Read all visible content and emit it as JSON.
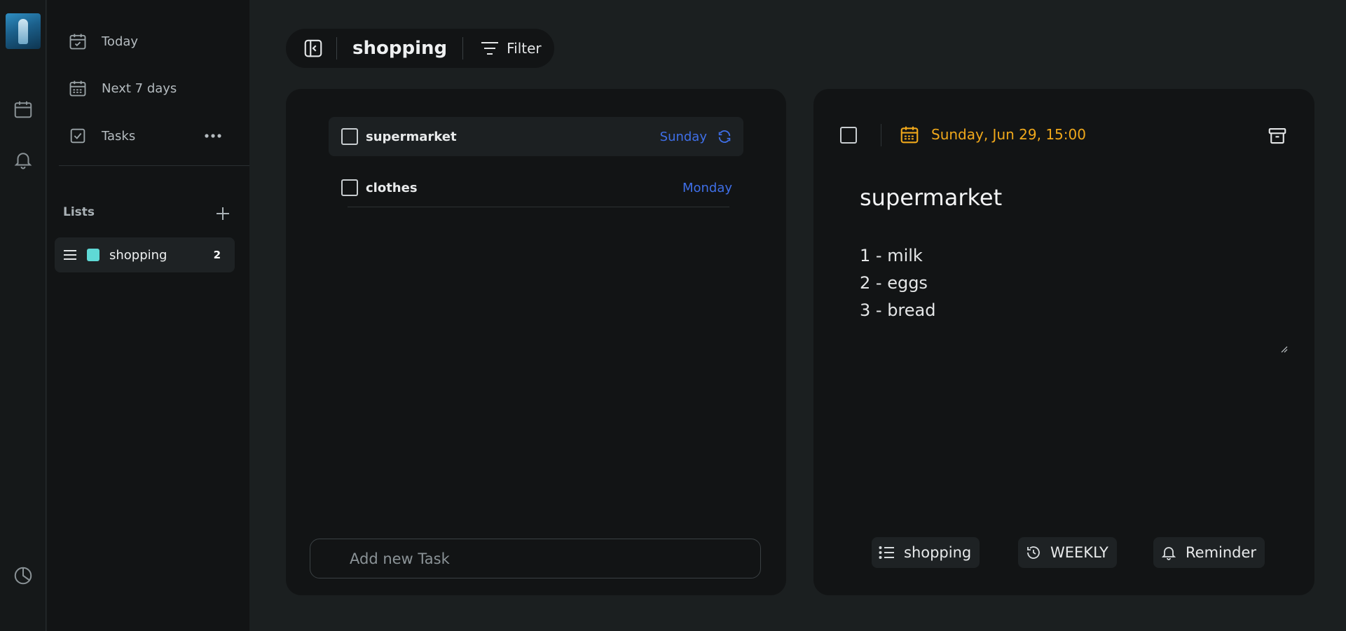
{
  "sidebar": {
    "nav": [
      {
        "label": "Today",
        "icon": "calendar-check-icon"
      },
      {
        "label": "Next 7 days",
        "icon": "calendar-grid-icon"
      },
      {
        "label": "Tasks",
        "icon": "checkbox-icon"
      }
    ],
    "lists_header": "Lists",
    "lists": [
      {
        "name": "shopping",
        "count": "2",
        "color": "#5fd9d6"
      }
    ]
  },
  "toolbar": {
    "list_title": "shopping",
    "filter_label": "Filter"
  },
  "tasks": [
    {
      "title": "supermarket",
      "due": "Sunday",
      "repeat": true
    },
    {
      "title": "clothes",
      "due": "Monday",
      "repeat": false
    }
  ],
  "add_task": {
    "placeholder": "Add new Task"
  },
  "detail": {
    "due_date": "Sunday, Jun 29, 15:00",
    "title": "supermarket",
    "notes": [
      "1 - milk",
      "2 - eggs",
      "3 - bread"
    ],
    "chips": {
      "list": "shopping",
      "repeat": "WEEKLY",
      "reminder": "Reminder"
    }
  },
  "colors": {
    "accent_blue": "#3f6fe8",
    "date_orange": "#f0a81b",
    "list_teal": "#5fd9d6"
  }
}
